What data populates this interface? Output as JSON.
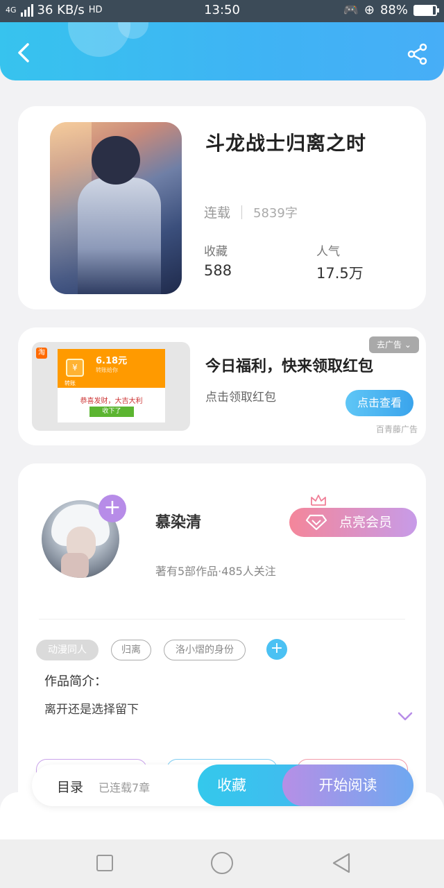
{
  "status_bar": {
    "network": "4G",
    "speed": "36 KB/s",
    "hd": "HD",
    "time": "13:50",
    "battery": "88%",
    "battery_level": 0.88
  },
  "book": {
    "title": "斗龙战士归离之时",
    "status": "连载",
    "word_count": "5839字",
    "favorites_label": "收藏",
    "favorites_value": "588",
    "popularity_label": "人气",
    "popularity_value": "17.5万"
  },
  "ad": {
    "tag": "去广告",
    "title": "今日福利，快来领取红包",
    "subtitle": "点击领取红包",
    "button": "点击查看",
    "source": "百青藤广告",
    "image": {
      "app_badge": "淘",
      "amount": "6.18元",
      "sub": "转账给你",
      "small": "转账",
      "wish": "恭喜发财，大吉大利",
      "received": "收下了"
    }
  },
  "author": {
    "name": "慕染清",
    "info": "著有5部作品·485人关注",
    "vip_button": "点亮会员",
    "follow_symbol": "+"
  },
  "tags": [
    "动漫同人",
    "归离",
    "洛小熠的身份"
  ],
  "add_tag_symbol": "+",
  "intro": {
    "label": "作品简介：",
    "text": "离开还是选择留下"
  },
  "action_bar": {
    "catalog": "目录",
    "serialized": "已连载7章",
    "collect": "收藏",
    "start_reading": "开始阅读"
  },
  "colors": {
    "header": "#3fb3f4",
    "accent_blue": "#34c8ec",
    "purple": "#b78ce8",
    "vip_pink": "#f4869a"
  }
}
